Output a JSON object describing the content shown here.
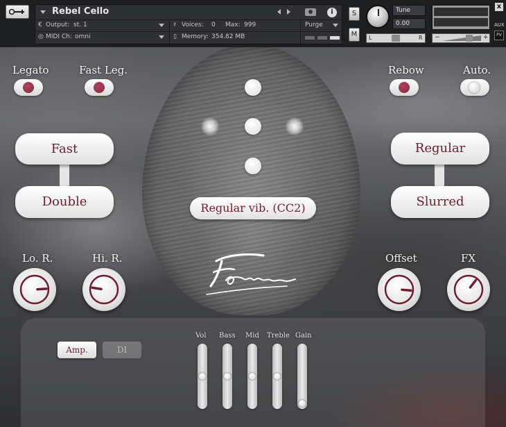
{
  "header": {
    "instrument_name": "Rebel Cello",
    "output_label": "Output:",
    "output_value": "st. 1",
    "midi_label": "MIDI Ch:",
    "midi_value": "omni",
    "voices_label": "Voices:",
    "voices_value": "0",
    "max_label": "Max:",
    "max_value": "999",
    "memory_label": "Memory:",
    "memory_value": "354.82 MB",
    "purge_label": "Purge",
    "solo_label": "S",
    "mute_label": "M",
    "tune_label": "Tune",
    "tune_value": "0.00",
    "pan_left": "L",
    "pan_right": "R",
    "pan_center": "C",
    "vol_minus": "−",
    "vol_plus": "+",
    "close": "x",
    "aux": "AUX",
    "pv": "PV",
    "info": "i"
  },
  "controls": {
    "legato": {
      "label": "Legato",
      "on": true
    },
    "fast_leg": {
      "label": "Fast Leg.",
      "on": true
    },
    "rebow": {
      "label": "Rebow",
      "on": true
    },
    "auto": {
      "label": "Auto.",
      "on": false
    },
    "fast_label": "Fast",
    "double_label": "Double",
    "regular_label": "Regular",
    "slurred_label": "Slurred",
    "vibrato_label": "Regular vib. (CC2)",
    "lo_r": "Lo. R.",
    "hi_r": "Hi. R.",
    "offset": "Offset",
    "fx": "FX",
    "knob_levels": {
      "lo_r": 0.82,
      "hi_r": 0.2,
      "offset": 0.85,
      "fx": 0.64
    }
  },
  "bottom": {
    "amp_label": "Amp.",
    "di_label": "DI",
    "eq": [
      {
        "label": "Vol",
        "level": 0.5
      },
      {
        "label": "Bass",
        "level": 0.5
      },
      {
        "label": "Mid",
        "level": 0.5
      },
      {
        "label": "Treble",
        "level": 0.5
      },
      {
        "label": "Gain",
        "level": 0.0
      }
    ]
  },
  "colors": {
    "accent": "#6e1d30",
    "led_on": "#8a2a41"
  }
}
